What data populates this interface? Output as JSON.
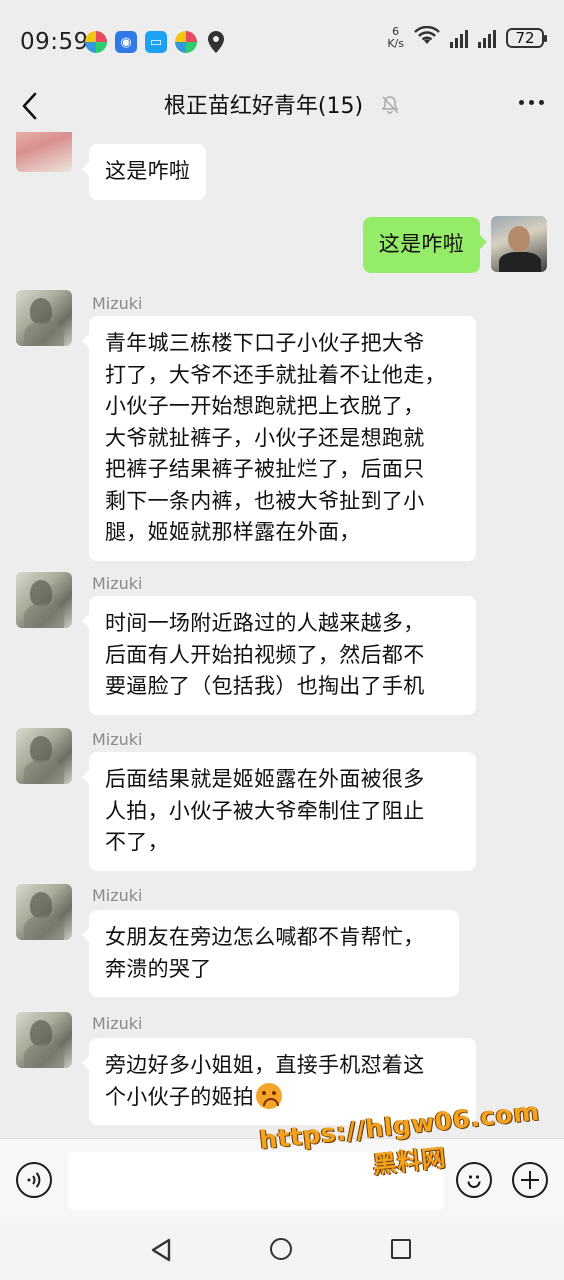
{
  "status_bar": {
    "time": "09:59",
    "net_speed_value": "6",
    "net_speed_unit": "K/s",
    "battery": "72"
  },
  "header": {
    "title": "根正苗红好青年(15)"
  },
  "messages": [
    {
      "sender": "",
      "side": "left",
      "text": "这是咋啦"
    },
    {
      "sender": "",
      "side": "right",
      "text": "这是咋啦"
    },
    {
      "sender": "Mizuki",
      "side": "left",
      "text": "青年城三栋楼下口子小伙子把大爷\n打了，大爷不还手就扯着不让他走，\n小伙子一开始想跑就把上衣脱了，\n大爷就扯裤子，小伙子还是想跑就\n把裤子结果裤子被扯烂了，后面只\n剩下一条内裤，也被大爷扯到了小\n腿，姬姬就那样露在外面，"
    },
    {
      "sender": "Mizuki",
      "side": "left",
      "text": "时间一场附近路过的人越来越多，\n后面有人开始拍视频了，然后都不\n要逼脸了（包括我）也掏出了手机"
    },
    {
      "sender": "Mizuki",
      "side": "left",
      "text": "后面结果就是姬姬露在外面被很多\n人拍，小伙子被大爷牵制住了阻止\n不了，"
    },
    {
      "sender": "Mizuki",
      "side": "left",
      "text": "女朋友在旁边怎么喊都不肯帮忙，\n奔溃的哭了"
    },
    {
      "sender": "Mizuki",
      "side": "left",
      "text": "旁边好多小姐姐，直接手机怼着这\n个小伙子的姬拍"
    }
  ],
  "input_bar": {
    "placeholder": ""
  },
  "watermark": {
    "url": "https://hlgw06.com",
    "name": "黑料网"
  },
  "icons": {
    "back": "back-arrow-icon",
    "mute": "bell-off-icon",
    "more": "more-dots-icon",
    "voice": "voice-icon",
    "emoji": "emoji-icon",
    "plus": "plus-icon"
  },
  "colors": {
    "background": "#ededed",
    "self_bubble": "#95ec69",
    "other_bubble": "#ffffff",
    "watermark": "#f5a21e"
  }
}
